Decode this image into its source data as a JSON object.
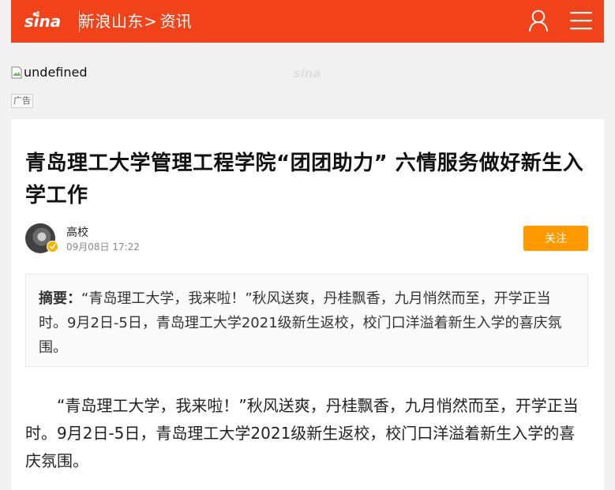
{
  "header": {
    "logo_text": "sina",
    "site_name": "新浪山东",
    "crumb_chevron": ">",
    "section": "资讯",
    "accent": "#f2421a"
  },
  "ad": {
    "broken_image_alt": "undefined",
    "watermark_text": "sina",
    "tag": "广告"
  },
  "article": {
    "title": "青岛理工大学管理工程学院“团团助力” 六情服务做好新生入学工作",
    "author": {
      "name": "高校",
      "time": "09月08日   17:22",
      "avatar_icon": "avatar-image",
      "badge_icon": "verified-badge-icon"
    },
    "follow_label": "关注",
    "follow_color": "#ff9900",
    "summary": {
      "label": "摘要：",
      "text": "“青岛理工大学，我来啦！”秋风送爽，丹桂飘香，九月悄然而至，开学正当时。9月2日-5日，青岛理工大学2021级新生返校，校门口洋溢着新生入学的喜庆氛围。"
    },
    "body": "“青岛理工大学，我来啦！”秋风送爽，丹桂飘香，九月悄然而至，开学正当时。9月2日-5日，青岛理工大学2021级新生返校，校门口洋溢着新生入学的喜庆氛围。"
  },
  "icons": {
    "user": "user-icon",
    "menu": "menu-icon",
    "logo": "sina-logo"
  }
}
